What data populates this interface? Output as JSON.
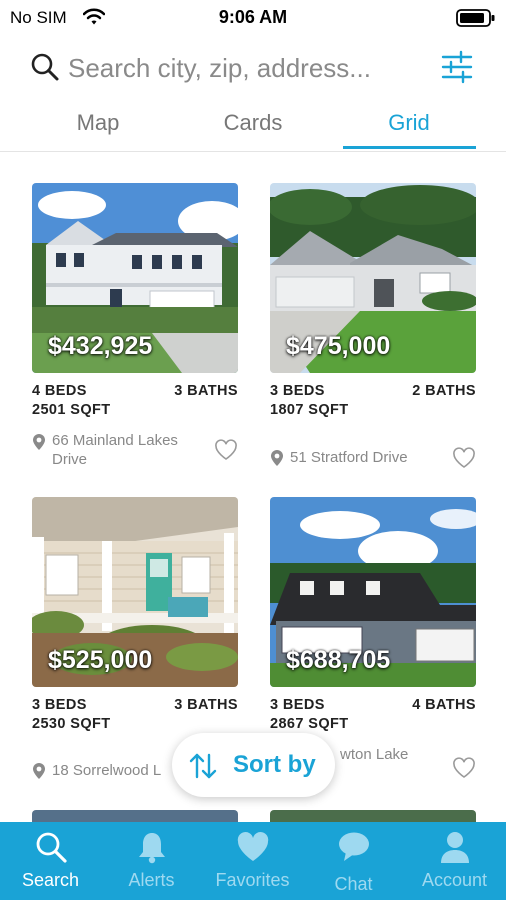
{
  "status_bar": {
    "carrier": "No SIM",
    "time": "9:06 AM"
  },
  "search": {
    "placeholder": "Search city, zip, address..."
  },
  "view_tabs": [
    {
      "label": "Map",
      "active": false
    },
    {
      "label": "Cards",
      "active": false
    },
    {
      "label": "Grid",
      "active": true
    }
  ],
  "listings": [
    {
      "price": "$432,925",
      "beds": "4 BEDS",
      "baths": "3 BATHS",
      "sqft": "2501 SQFT",
      "address": "66 Mainland Lakes Drive"
    },
    {
      "price": "$475,000",
      "beds": "3 BEDS",
      "baths": "2 BATHS",
      "sqft": "1807 SQFT",
      "address": "51 Stratford Drive"
    },
    {
      "price": "$525,000",
      "beds": "3 BEDS",
      "baths": "3 BATHS",
      "sqft": "2530 SQFT",
      "address": "18 Sorrelwood L"
    },
    {
      "price": "$688,705",
      "beds": "3 BEDS",
      "baths": "4 BATHS",
      "sqft": "2867 SQFT",
      "address": "wton Lake"
    }
  ],
  "sort_button": {
    "label": "Sort by"
  },
  "bottom_nav": [
    {
      "label": "Search",
      "icon": "search-icon",
      "active": true
    },
    {
      "label": "Alerts",
      "icon": "bell-icon",
      "active": false
    },
    {
      "label": "Favorites",
      "icon": "heart-icon",
      "active": false
    },
    {
      "label": "Chat",
      "icon": "chat-bubble-icon",
      "active": false
    },
    {
      "label": "Account",
      "icon": "person-icon",
      "active": false
    }
  ],
  "colors": {
    "accent": "#1aa3d6",
    "tabbar_inactive": "#9ed9f0",
    "text_secondary": "#888888"
  }
}
